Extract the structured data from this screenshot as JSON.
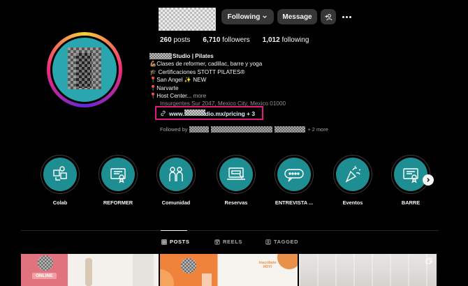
{
  "header": {
    "following_label": "Following",
    "message_label": "Message"
  },
  "stats": {
    "posts_count": "260",
    "posts_label": "posts",
    "followers_count": "6,710",
    "followers_label": "followers",
    "following_count": "1,012",
    "following_label": "following"
  },
  "bio": {
    "name_visible": "Studio | Pilates",
    "line1": "💪🏽Clases de reformer, cadillac, barre y yoga",
    "line2": "🎓 Certificaciones STOTT PILATES®",
    "line3": "📍San Angel ✨ NEW",
    "line4": "📍Narvarte",
    "line5": "📍Host Center...",
    "more_label": "more",
    "address": "Insurgentes Sur 2047, Mexico City, Mexico 01000",
    "link_prefix": "www.",
    "link_suffix": "dio.mx/pricing + 3",
    "followed_by_prefix": "Followed by",
    "followed_by_suffix": "+ 2 more"
  },
  "highlights": [
    {
      "label": "Colab",
      "icon": "collab-puzzle-icon"
    },
    {
      "label": "REFORMER",
      "icon": "certificate-icon"
    },
    {
      "label": "Comunidad",
      "icon": "people-icon"
    },
    {
      "label": "Reservas",
      "icon": "laptop-booking-icon"
    },
    {
      "label": "ENTREVISTA ...",
      "icon": "chat-bubble-icon"
    },
    {
      "label": "Eventos",
      "icon": "party-popper-icon"
    },
    {
      "label": "BARRE",
      "icon": "certificate-icon"
    }
  ],
  "tabs": [
    {
      "label": "POSTS",
      "icon": "grid-icon",
      "active": true
    },
    {
      "label": "REELS",
      "icon": "reels-icon",
      "active": false
    },
    {
      "label": "TAGGED",
      "icon": "tagged-icon",
      "active": false
    }
  ],
  "grid": {
    "tile1_badge": "ONLINE",
    "tile2_text": "Inscribete HOY!"
  },
  "colors": {
    "link_highlight_border": "#e0197f",
    "highlight_fill": "#1f8e93",
    "button_bg": "#363636"
  }
}
